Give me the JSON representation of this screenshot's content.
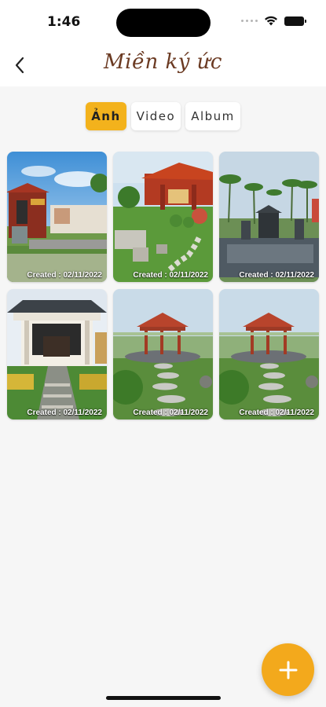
{
  "status_bar": {
    "time": "1:46",
    "icons": [
      "signal-icon",
      "wifi-icon",
      "battery-icon"
    ]
  },
  "header": {
    "title": "Miền ký ức",
    "back_icon": "chevron-left-icon"
  },
  "tabs": [
    {
      "label": "Ảnh",
      "active": true
    },
    {
      "label": "Video",
      "active": false
    },
    {
      "label": "Album",
      "active": false
    }
  ],
  "photos": [
    {
      "caption": "Created : 02/11/2022",
      "scene": "temple-gate"
    },
    {
      "caption": "Created : 02/11/2022",
      "scene": "pavilion-garden"
    },
    {
      "caption": "Created : 02/11/2022",
      "scene": "tombs-palms"
    },
    {
      "caption": "Created : 02/11/2022",
      "scene": "shrine-hall"
    },
    {
      "caption": "Created : 02/11/2022",
      "scene": "gazebo-stepping-stones"
    },
    {
      "caption": "Created : 02/11/2022",
      "scene": "gazebo-stepping-stones"
    }
  ],
  "fab": {
    "icon": "plus-icon"
  },
  "colors": {
    "accent": "#f3b21c",
    "fab": "#f3a91c",
    "title": "#6b3a22",
    "background": "#f6f6f6"
  }
}
